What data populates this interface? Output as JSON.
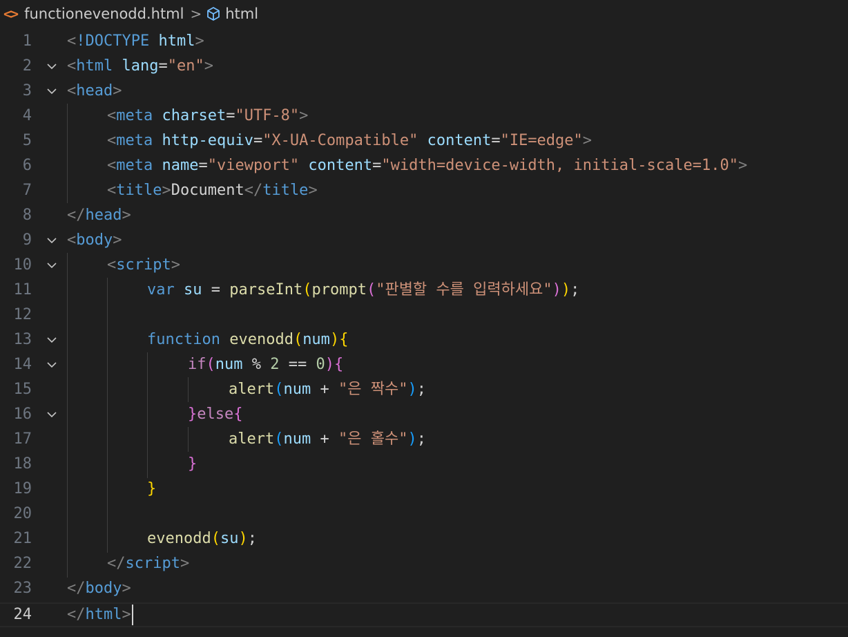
{
  "breadcrumb": {
    "file_icon": "<>",
    "file_name": "functionevenodd.html",
    "separator": ">",
    "symbol_name": "html"
  },
  "editor": {
    "current_line": 24,
    "lines": [
      {
        "n": "1"
      },
      {
        "n": "2"
      },
      {
        "n": "3"
      },
      {
        "n": "4"
      },
      {
        "n": "5"
      },
      {
        "n": "6"
      },
      {
        "n": "7"
      },
      {
        "n": "8"
      },
      {
        "n": "9"
      },
      {
        "n": "10"
      },
      {
        "n": "11"
      },
      {
        "n": "12"
      },
      {
        "n": "13"
      },
      {
        "n": "14"
      },
      {
        "n": "15"
      },
      {
        "n": "16"
      },
      {
        "n": "17"
      },
      {
        "n": "18"
      },
      {
        "n": "19"
      },
      {
        "n": "20"
      },
      {
        "n": "21"
      },
      {
        "n": "22"
      },
      {
        "n": "23"
      },
      {
        "n": "24"
      }
    ],
    "tokens": {
      "lt": "<",
      "gt": ">",
      "lt_slash": "</",
      "eq": "=",
      "doctype": "!DOCTYPE",
      "html": "html",
      "lang": "lang",
      "en": "\"en\"",
      "head": "head",
      "meta": "meta",
      "charset": "charset",
      "utf8": "\"UTF-8\"",
      "http_equiv": "http-equiv",
      "xua": "\"X-UA-Compatible\"",
      "content": "content",
      "ie_edge": "\"IE=edge\"",
      "name": "name",
      "viewport": "\"viewport\"",
      "viewport_content": "\"width=device-width, initial-scale=1.0\"",
      "title": "title",
      "document": "Document",
      "body": "body",
      "script": "script",
      "var": "var",
      "su": "su",
      "assign": " = ",
      "parseInt": "parseInt",
      "lparen": "(",
      "rparen": ")",
      "prompt": "prompt",
      "prompt_str": "\"판별할 수를 입력하세요\"",
      "semi": ";",
      "function": "function",
      "evenodd": "evenodd",
      "num": "num",
      "lbrace": "{",
      "rbrace": "}",
      "if": "if",
      "mod": " % ",
      "two": "2",
      "eqeq": " == ",
      "zero": "0",
      "alert": "alert",
      "plus": " + ",
      "even_str": "\"은 짝수\"",
      "else": "else",
      "odd_str": "\"은 홀수\""
    }
  },
  "colors": {
    "background": "#1f1f1f",
    "tag": "#569cd6",
    "attribute": "#9cdcfe",
    "string": "#ce9178",
    "function": "#dcdcaa",
    "control": "#c586c0",
    "bracket_gold": "#ffd700",
    "bracket_orchid": "#da70d6",
    "bracket_blue": "#179fff"
  },
  "icons": {
    "file": "html-file-icon",
    "symbol": "symbol-cube-icon",
    "fold": "chevron-down-icon"
  }
}
